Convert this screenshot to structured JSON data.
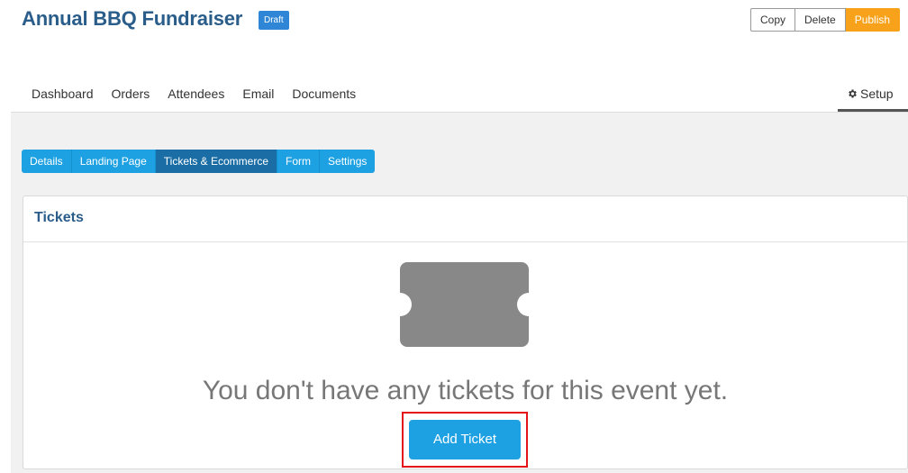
{
  "header": {
    "title": "Annual BBQ Fundraiser",
    "badge": "Draft",
    "actions": {
      "copy": "Copy",
      "delete": "Delete",
      "publish": "Publish"
    }
  },
  "nav": {
    "items": [
      "Dashboard",
      "Orders",
      "Attendees",
      "Email",
      "Documents"
    ],
    "setup": "Setup"
  },
  "subtabs": {
    "items": [
      "Details",
      "Landing Page",
      "Tickets & Ecommerce",
      "Form",
      "Settings"
    ],
    "active": "Tickets & Ecommerce"
  },
  "panel": {
    "title": "Tickets",
    "icon": "ticket-icon",
    "empty_message": "You don't have any tickets for this event yet.",
    "add_button": "Add Ticket"
  },
  "colors": {
    "brand_blue": "#2a5d8a",
    "tab_blue": "#1da1e2",
    "tab_active": "#1b6ea5",
    "publish_orange": "#f7a21a",
    "highlight_red": "#e5141a"
  }
}
